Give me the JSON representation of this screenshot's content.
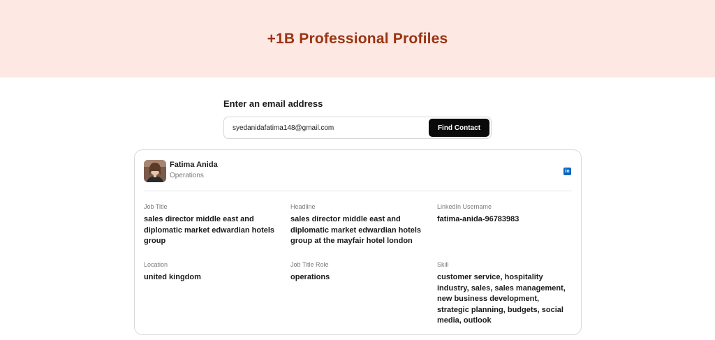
{
  "header": {
    "title": "+1B Professional Profiles"
  },
  "search": {
    "label": "Enter an email address",
    "value": "syedanidafatima148@gmail.com",
    "button_label": "Find Contact"
  },
  "profile": {
    "name": "Fatima Anida",
    "department": "Operations",
    "linkedin_icon": "linkedin-icon",
    "fields": {
      "job_title": {
        "label": "Job Title",
        "value": "sales director middle east and diplomatic market edwardian hotels group"
      },
      "headline": {
        "label": "Headline",
        "value": "sales director middle east and diplomatic market edwardian hotels group at the mayfair hotel london"
      },
      "linkedin_username": {
        "label": "LinkedIn Username",
        "value": "fatima-anida-96783983"
      },
      "location": {
        "label": "Location",
        "value": "united kingdom"
      },
      "job_title_role": {
        "label": "Job Title Role",
        "value": "operations"
      },
      "skill": {
        "label": "Skill",
        "value": "customer service, hospitality industry, sales, sales management, new business development, strategic planning, budgets, social media, outlook"
      }
    }
  },
  "colors": {
    "hero_bg": "#fde8e3",
    "title": "#9a3412",
    "button": "#0a0a0a",
    "linkedin": "#0a66c2"
  }
}
